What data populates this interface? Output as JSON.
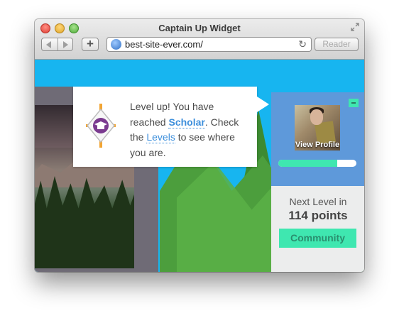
{
  "window": {
    "title": "Captain Up Widget"
  },
  "toolbar": {
    "url": "best-site-ever.com/",
    "reader_label": "Reader",
    "add_label": "+"
  },
  "icons": {
    "back": "back-arrow-icon",
    "forward": "forward-arrow-icon",
    "globe": "globe-icon",
    "reload": "reload-icon",
    "fullscreen": "fullscreen-icon",
    "badge": "graduation-cap-badge-icon"
  },
  "notification": {
    "line_start": "Level up! You have reached ",
    "level_name": "Scholar",
    "line_mid": ". Check the ",
    "levels_link": "Levels",
    "line_end": " to see where you are."
  },
  "widget": {
    "view_profile": "View Profile",
    "minimize_label": "-",
    "progress_fraction": 0.75,
    "next_level_label": "Next Level in",
    "points_label": "114 points",
    "community_button": "Community"
  },
  "colors": {
    "accent_green": "#3fe7b0",
    "panel_blue": "#5e99da",
    "link_blue": "#3d8fdc",
    "sky": "#17b5f0",
    "forest": "#4c9e3d"
  }
}
